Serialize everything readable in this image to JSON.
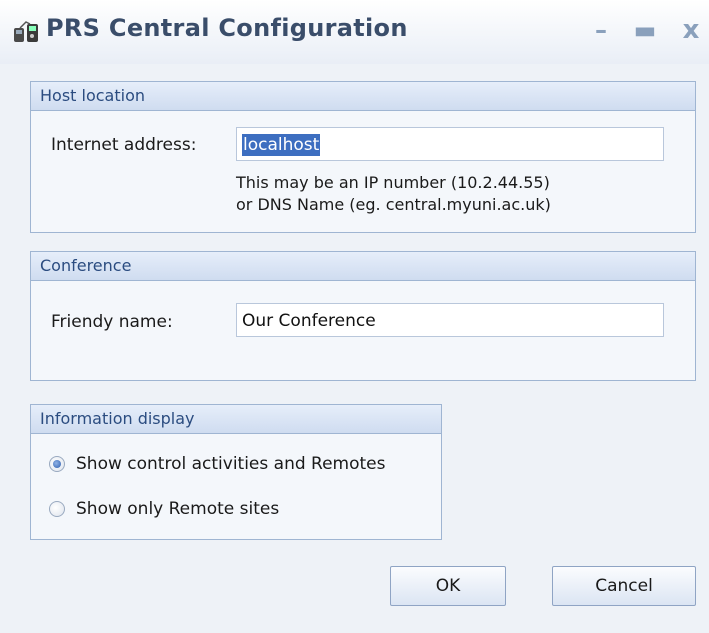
{
  "window": {
    "title": "PRS Central Configuration",
    "minimize_glyph": "–",
    "maximize_glyph": "▬",
    "close_glyph": "x"
  },
  "host": {
    "header": "Host location",
    "address_label": "Internet address:",
    "address_value": "localhost",
    "hint_line1": "This may be an IP number (10.2.44.55)",
    "hint_line2": "or DNS Name (eg. central.myuni.ac.uk)"
  },
  "conference": {
    "header": "Conference",
    "name_label": "Friendy name:",
    "name_value": "Our Conference"
  },
  "info": {
    "header": "Information display",
    "options": [
      {
        "label": "Show control activities and Remotes",
        "checked": true
      },
      {
        "label": "Show only Remote sites",
        "checked": false
      }
    ]
  },
  "buttons": {
    "ok_label": "OK",
    "cancel_label": "Cancel"
  }
}
